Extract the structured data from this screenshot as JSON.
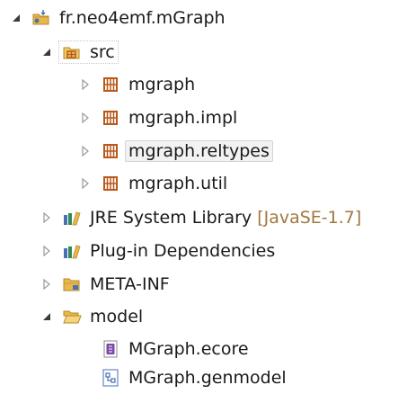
{
  "tree": {
    "project": {
      "label": "fr.neo4emf.mGraph"
    },
    "src": {
      "label": "src"
    },
    "packages": [
      {
        "label": "mgraph"
      },
      {
        "label": "mgraph.impl"
      },
      {
        "label": "mgraph.reltypes"
      },
      {
        "label": "mgraph.util"
      }
    ],
    "jre": {
      "label": "JRE System Library",
      "decoration": "[JavaSE-1.7]"
    },
    "plugin_deps": {
      "label": "Plug-in Dependencies"
    },
    "meta_inf": {
      "label": "META-INF"
    },
    "model": {
      "label": "model"
    },
    "model_files": [
      {
        "label": "MGraph.ecore"
      },
      {
        "label": "MGraph.genmodel"
      }
    ]
  },
  "colors": {
    "expanded_arrow": "#3a3a3a",
    "collapsed_arrow": "#9a9a9a",
    "package_icon": "#b8591a",
    "folder_icon": "#e8b84a",
    "library_icon": "#4a6fb5",
    "decoration_text": "#a07840"
  }
}
